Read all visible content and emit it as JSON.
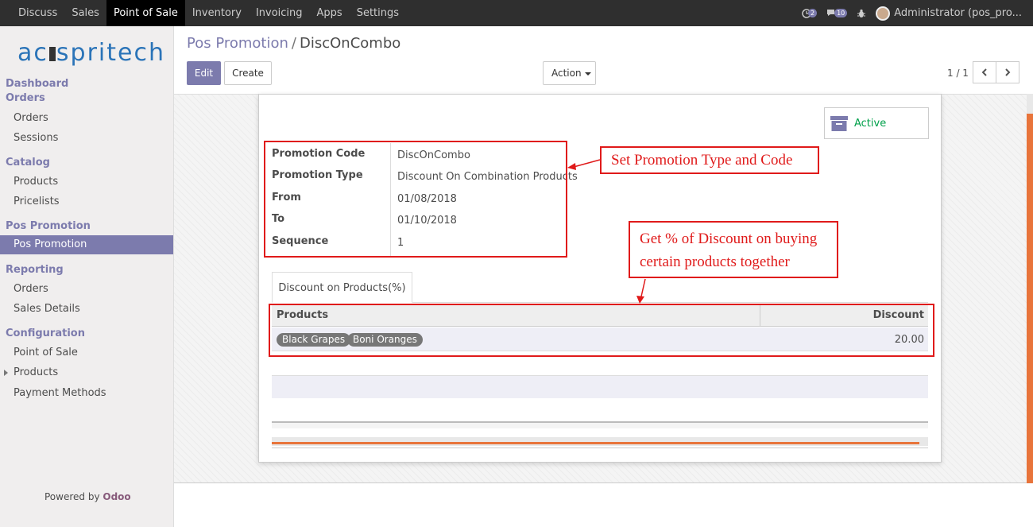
{
  "topbar": {
    "menu": [
      "Discuss",
      "Sales",
      "Point of Sale",
      "Inventory",
      "Invoicing",
      "Apps",
      "Settings"
    ],
    "active_index": 2,
    "chat_badge": "2",
    "activity_badge": "10",
    "user": "Administrator (pos_pro..."
  },
  "sidebar": {
    "logo": "acespritech",
    "sections": {
      "dashboard": "Dashboard",
      "orders": "Orders",
      "orders_items": [
        "Orders",
        "Sessions"
      ],
      "catalog": "Catalog",
      "catalog_items": [
        "Products",
        "Pricelists"
      ],
      "pos_promotion": "Pos Promotion",
      "pos_promotion_items": [
        "Pos Promotion"
      ],
      "reporting": "Reporting",
      "reporting_items": [
        "Orders",
        "Sales Details"
      ],
      "configuration": "Configuration",
      "configuration_items": [
        "Point of Sale",
        "Products",
        "Payment Methods"
      ]
    },
    "powered_by": "Powered by",
    "powered_brand": "Odoo"
  },
  "control": {
    "breadcrumb_parent": "Pos Promotion",
    "breadcrumb_sep": "/",
    "breadcrumb_current": "DiscOnCombo",
    "edit": "Edit",
    "create": "Create",
    "action": "Action",
    "pager": "1 / 1"
  },
  "form": {
    "active_label": "Active",
    "fields": [
      {
        "label": "Promotion Code",
        "value": "DiscOnCombo"
      },
      {
        "label": "Promotion Type",
        "value": "Discount On Combination Products"
      },
      {
        "label": "From",
        "value": "01/08/2018"
      },
      {
        "label": "To",
        "value": "01/10/2018"
      },
      {
        "label": "Sequence",
        "value": "1"
      }
    ],
    "tab_label": "Discount on Products(%)",
    "table": {
      "headers": [
        "Products",
        "Discount"
      ],
      "rows": [
        {
          "tags": [
            "Black Grapes",
            "Boni Oranges"
          ],
          "discount": "20.00"
        }
      ]
    }
  },
  "annotations": {
    "callout1": "Set Promotion Type and Code",
    "callout2_line1": "Get % of Discount on buying",
    "callout2_line2": "certain products together"
  },
  "colors": {
    "brand": "#7c7bad",
    "annotation": "#e01a1a",
    "accent": "#e8743b"
  }
}
